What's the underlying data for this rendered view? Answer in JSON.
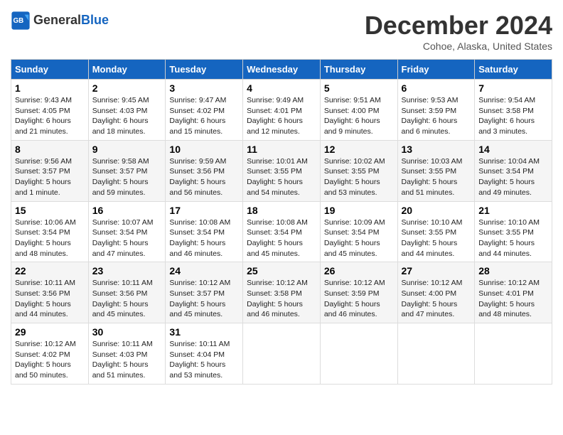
{
  "header": {
    "logo_line1": "General",
    "logo_line2": "Blue",
    "title": "December 2024",
    "subtitle": "Cohoe, Alaska, United States"
  },
  "columns": [
    "Sunday",
    "Monday",
    "Tuesday",
    "Wednesday",
    "Thursday",
    "Friday",
    "Saturday"
  ],
  "weeks": [
    [
      {
        "day": "1",
        "rise": "9:43 AM",
        "set": "4:05 PM",
        "daylight": "6 hours and 21 minutes."
      },
      {
        "day": "2",
        "rise": "9:45 AM",
        "set": "4:03 PM",
        "daylight": "6 hours and 18 minutes."
      },
      {
        "day": "3",
        "rise": "9:47 AM",
        "set": "4:02 PM",
        "daylight": "6 hours and 15 minutes."
      },
      {
        "day": "4",
        "rise": "9:49 AM",
        "set": "4:01 PM",
        "daylight": "6 hours and 12 minutes."
      },
      {
        "day": "5",
        "rise": "9:51 AM",
        "set": "4:00 PM",
        "daylight": "6 hours and 9 minutes."
      },
      {
        "day": "6",
        "rise": "9:53 AM",
        "set": "3:59 PM",
        "daylight": "6 hours and 6 minutes."
      },
      {
        "day": "7",
        "rise": "9:54 AM",
        "set": "3:58 PM",
        "daylight": "6 hours and 3 minutes."
      }
    ],
    [
      {
        "day": "8",
        "rise": "9:56 AM",
        "set": "3:57 PM",
        "daylight": "5 hours and 1 minute."
      },
      {
        "day": "9",
        "rise": "9:58 AM",
        "set": "3:57 PM",
        "daylight": "5 hours and 59 minutes."
      },
      {
        "day": "10",
        "rise": "9:59 AM",
        "set": "3:56 PM",
        "daylight": "5 hours and 56 minutes."
      },
      {
        "day": "11",
        "rise": "10:01 AM",
        "set": "3:55 PM",
        "daylight": "5 hours and 54 minutes."
      },
      {
        "day": "12",
        "rise": "10:02 AM",
        "set": "3:55 PM",
        "daylight": "5 hours and 53 minutes."
      },
      {
        "day": "13",
        "rise": "10:03 AM",
        "set": "3:55 PM",
        "daylight": "5 hours and 51 minutes."
      },
      {
        "day": "14",
        "rise": "10:04 AM",
        "set": "3:54 PM",
        "daylight": "5 hours and 49 minutes."
      }
    ],
    [
      {
        "day": "15",
        "rise": "10:06 AM",
        "set": "3:54 PM",
        "daylight": "5 hours and 48 minutes."
      },
      {
        "day": "16",
        "rise": "10:07 AM",
        "set": "3:54 PM",
        "daylight": "5 hours and 47 minutes."
      },
      {
        "day": "17",
        "rise": "10:08 AM",
        "set": "3:54 PM",
        "daylight": "5 hours and 46 minutes."
      },
      {
        "day": "18",
        "rise": "10:08 AM",
        "set": "3:54 PM",
        "daylight": "5 hours and 45 minutes."
      },
      {
        "day": "19",
        "rise": "10:09 AM",
        "set": "3:54 PM",
        "daylight": "5 hours and 45 minutes."
      },
      {
        "day": "20",
        "rise": "10:10 AM",
        "set": "3:55 PM",
        "daylight": "5 hours and 44 minutes."
      },
      {
        "day": "21",
        "rise": "10:10 AM",
        "set": "3:55 PM",
        "daylight": "5 hours and 44 minutes."
      }
    ],
    [
      {
        "day": "22",
        "rise": "10:11 AM",
        "set": "3:56 PM",
        "daylight": "5 hours and 44 minutes."
      },
      {
        "day": "23",
        "rise": "10:11 AM",
        "set": "3:56 PM",
        "daylight": "5 hours and 45 minutes."
      },
      {
        "day": "24",
        "rise": "10:12 AM",
        "set": "3:57 PM",
        "daylight": "5 hours and 45 minutes."
      },
      {
        "day": "25",
        "rise": "10:12 AM",
        "set": "3:58 PM",
        "daylight": "5 hours and 46 minutes."
      },
      {
        "day": "26",
        "rise": "10:12 AM",
        "set": "3:59 PM",
        "daylight": "5 hours and 46 minutes."
      },
      {
        "day": "27",
        "rise": "10:12 AM",
        "set": "4:00 PM",
        "daylight": "5 hours and 47 minutes."
      },
      {
        "day": "28",
        "rise": "10:12 AM",
        "set": "4:01 PM",
        "daylight": "5 hours and 48 minutes."
      }
    ],
    [
      {
        "day": "29",
        "rise": "10:12 AM",
        "set": "4:02 PM",
        "daylight": "5 hours and 50 minutes."
      },
      {
        "day": "30",
        "rise": "10:11 AM",
        "set": "4:03 PM",
        "daylight": "5 hours and 51 minutes."
      },
      {
        "day": "31",
        "rise": "10:11 AM",
        "set": "4:04 PM",
        "daylight": "5 hours and 53 minutes."
      },
      null,
      null,
      null,
      null
    ]
  ]
}
